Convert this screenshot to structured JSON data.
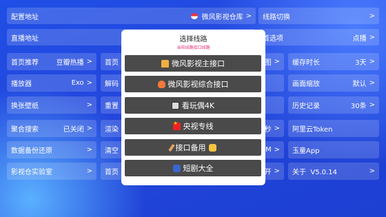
{
  "tiles": {
    "config_addr": {
      "label": "配置地址",
      "value": "微风影视仓库"
    },
    "route_switch": {
      "label": "线路切换"
    },
    "live_addr": {
      "label": "直播地址"
    },
    "homepage_choice": {
      "label": "首选项",
      "value": "点播"
    },
    "home_recommend": {
      "label": "首页推荐",
      "value": "豆瓣热播"
    },
    "col2_row3_partial": {
      "label": "首页"
    },
    "col3_row3_partial": {
      "label": "图"
    },
    "cache_duration": {
      "label": "缓存时长",
      "value": "3天"
    },
    "player": {
      "label": "播放器",
      "value": "Exo"
    },
    "col2_row4_partial": {
      "label": "解码"
    },
    "screen_zoom": {
      "label": "画面缩放",
      "value": "默认"
    },
    "wallpaper": {
      "label": "换张壁纸"
    },
    "col2_row5_partial": {
      "label": "重置"
    },
    "history": {
      "label": "历史记录",
      "value": "30条"
    },
    "agg_search": {
      "label": "聚合搜索",
      "value": "已关闭"
    },
    "col2_row6_partial": {
      "label": "渲染"
    },
    "col3_row6_partial": {
      "label": "秒"
    },
    "aliyun_token": {
      "label": "阿里云Token"
    },
    "backup_restore": {
      "label": "数据备份还原"
    },
    "col2_row7_partial": {
      "label": "清空"
    },
    "col3_row7_partial": {
      "label": "OM"
    },
    "ali_app": {
      "label": "玉童App"
    },
    "lab": {
      "label": "影视仓实验室"
    },
    "col2_row8_partial": {
      "label": "首页"
    },
    "col3_row8_partial": {
      "label": "开"
    },
    "about": {
      "label": "关于",
      "value": "V5.0.14"
    }
  },
  "chevron": ">",
  "modal": {
    "title": "选择线路",
    "subtitle": "当前线路接口线路",
    "options": [
      {
        "label": "微风影视主接口",
        "icon": "house-icon"
      },
      {
        "label": "微风影视综合接口",
        "icon": "bowl-icon"
      },
      {
        "label": "看玩偶4K",
        "icon": "clapperboard-icon"
      },
      {
        "label": "央视专线",
        "icon": "china-flag-icon"
      },
      {
        "label": "接口备用",
        "icon": "pencil-icon",
        "suffix_icon": "pointing-hand-icon"
      },
      {
        "label": "短剧大全",
        "icon": "group-icon"
      }
    ]
  }
}
